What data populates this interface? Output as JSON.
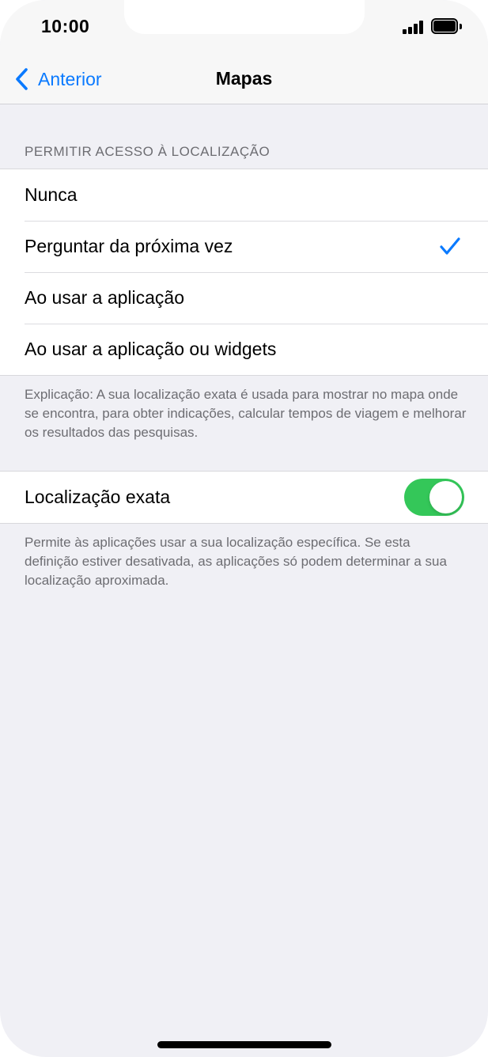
{
  "status_bar": {
    "time": "10:00",
    "icons": [
      "signal-icon",
      "battery-icon"
    ]
  },
  "nav": {
    "back_label": "Anterior",
    "title": "Mapas"
  },
  "location_access": {
    "header": "PERMITIR ACESSO À LOCALIZAÇÃO",
    "options": [
      {
        "label": "Nunca",
        "selected": false
      },
      {
        "label": "Perguntar da próxima vez",
        "selected": true
      },
      {
        "label": "Ao usar a aplicação",
        "selected": false
      },
      {
        "label": "Ao usar a aplicação ou widgets",
        "selected": false
      }
    ],
    "footer": "Explicação: A sua localização exata é usada para mostrar no mapa onde se encontra, para obter indicações, calcular tempos de viagem e melhorar os resultados das pesquisas."
  },
  "precise_location": {
    "label": "Localização exata",
    "enabled": true,
    "footer": "Permite às aplicações usar a sua localização específica. Se esta definição estiver desativada, as aplicações só podem determinar a sua localização aproximada."
  },
  "colors": {
    "accent": "#0a7aff",
    "toggle_on": "#34c759",
    "background": "#f0f0f5"
  }
}
